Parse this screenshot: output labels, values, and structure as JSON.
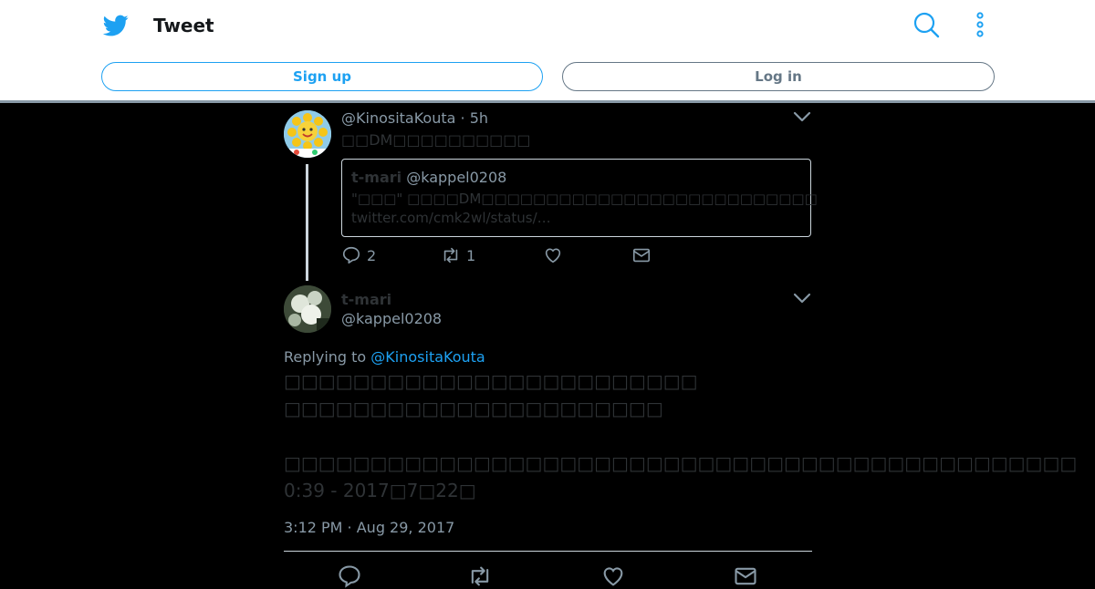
{
  "header": {
    "title": "Tweet",
    "signup_label": "Sign up",
    "login_label": "Log in"
  },
  "colors": {
    "brand": "#1da1f2",
    "secondary_text": "#8899a6",
    "primary_text_dim": "#2f3336",
    "background": "#000000"
  },
  "parent_tweet": {
    "display_name": "",
    "handle": "@KinositaKouta",
    "time": "5h",
    "text": "□□DM□□□□□□□□□□",
    "quoted": {
      "display_name": "t-mari",
      "handle": "@kappel0208",
      "line1": "\"□□□\" □□□□DM□□□□□□□□□□□□□□□□□□□□□□□□□□",
      "line2": "twitter.com/cmk2wl/status/…"
    },
    "actions": {
      "replies": "2",
      "retweets": "1",
      "likes": "",
      "dm": ""
    }
  },
  "main_tweet": {
    "display_name": "t-mari",
    "handle": "@kappel0208",
    "replying_prefix": "Replying to",
    "replying_to": "@KinositaKouta",
    "body_lines": [
      "□□□□□□□□□□□□□□□□□□□□□□□□",
      "□□□□□□□□□□□□□□□□□□□□□□",
      "",
      "□□□□□□□□□□□□□□□□□□□□□□□□□□□□□□□□□□□□□□□□□□□□□□",
      "0:39 - 2017□7□22□"
    ],
    "timestamp": "3:12 PM · Aug 29, 2017"
  },
  "icons": {
    "logo": "twitter-bird-icon",
    "search": "search-icon",
    "more": "more-vertical-icon",
    "caret": "chevron-down-icon",
    "reply": "reply-icon",
    "retweet": "retweet-icon",
    "like": "heart-icon",
    "dm": "envelope-icon"
  }
}
